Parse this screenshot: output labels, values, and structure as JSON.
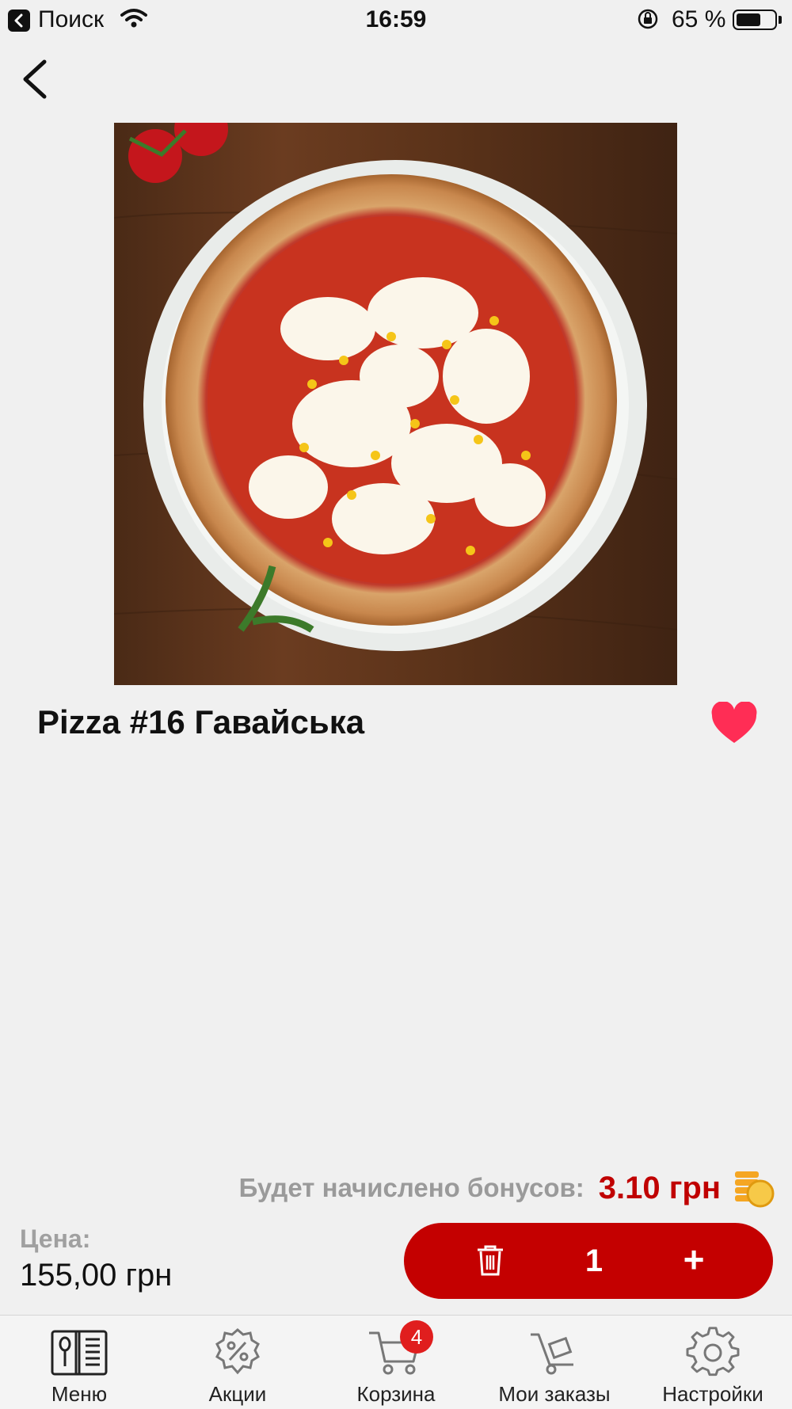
{
  "status_bar": {
    "carrier": "Поиск",
    "time": "16:59",
    "battery_percent": "65 %",
    "battery_level": 0.65
  },
  "product": {
    "title": "Pizza #16 Гавайська",
    "favorited": true
  },
  "bonus": {
    "label": "Будет начислено бонусов:",
    "value": "3.10 грн"
  },
  "price": {
    "label": "Цена:",
    "value": "155,00 грн"
  },
  "stepper": {
    "quantity": "1",
    "plus": "+"
  },
  "tabbar": {
    "cart_badge": "4",
    "items": [
      {
        "label": "Меню",
        "icon": "menu-book-icon"
      },
      {
        "label": "Акции",
        "icon": "discount-icon"
      },
      {
        "label": "Корзина",
        "icon": "cart-icon"
      },
      {
        "label": "Мои заказы",
        "icon": "orders-trolley-icon"
      },
      {
        "label": "Настройки",
        "icon": "gear-icon"
      }
    ]
  },
  "colors": {
    "accent": "#c40000",
    "heart": "#ff2d55",
    "coin": "#f5a623"
  }
}
